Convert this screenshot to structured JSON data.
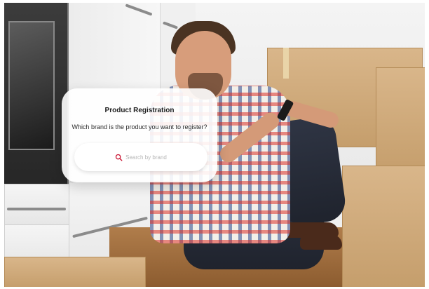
{
  "dialog": {
    "title": "Product Registration",
    "question": "Which brand is the product you want to register?",
    "search": {
      "placeholder": "Search by brand",
      "icon": "search-icon"
    }
  },
  "colors": {
    "accent": "#c8102e"
  }
}
